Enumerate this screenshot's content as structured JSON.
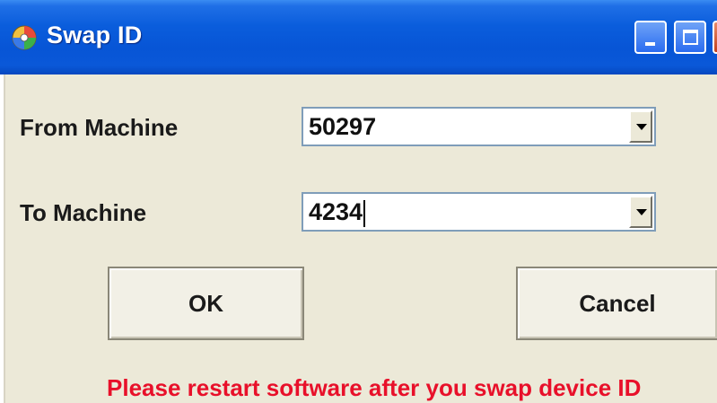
{
  "window": {
    "title": "Swap ID",
    "icon": "colorful-disc-app-icon"
  },
  "title_buttons": {
    "minimize_icon": "minimize-icon",
    "maximize_icon": "maximize-icon",
    "close_icon": "close-icon"
  },
  "form": {
    "from_label": "From Machine",
    "from_value": "50297",
    "to_label": "To Machine",
    "to_value": "4234"
  },
  "buttons": {
    "ok_label": "OK",
    "cancel_label": "Cancel"
  },
  "notice": {
    "text": "Please restart software after you swap device ID",
    "color": "#e8102a"
  },
  "colors": {
    "titlebar": "#0755d6",
    "dialog_bg": "#ece9d8"
  }
}
